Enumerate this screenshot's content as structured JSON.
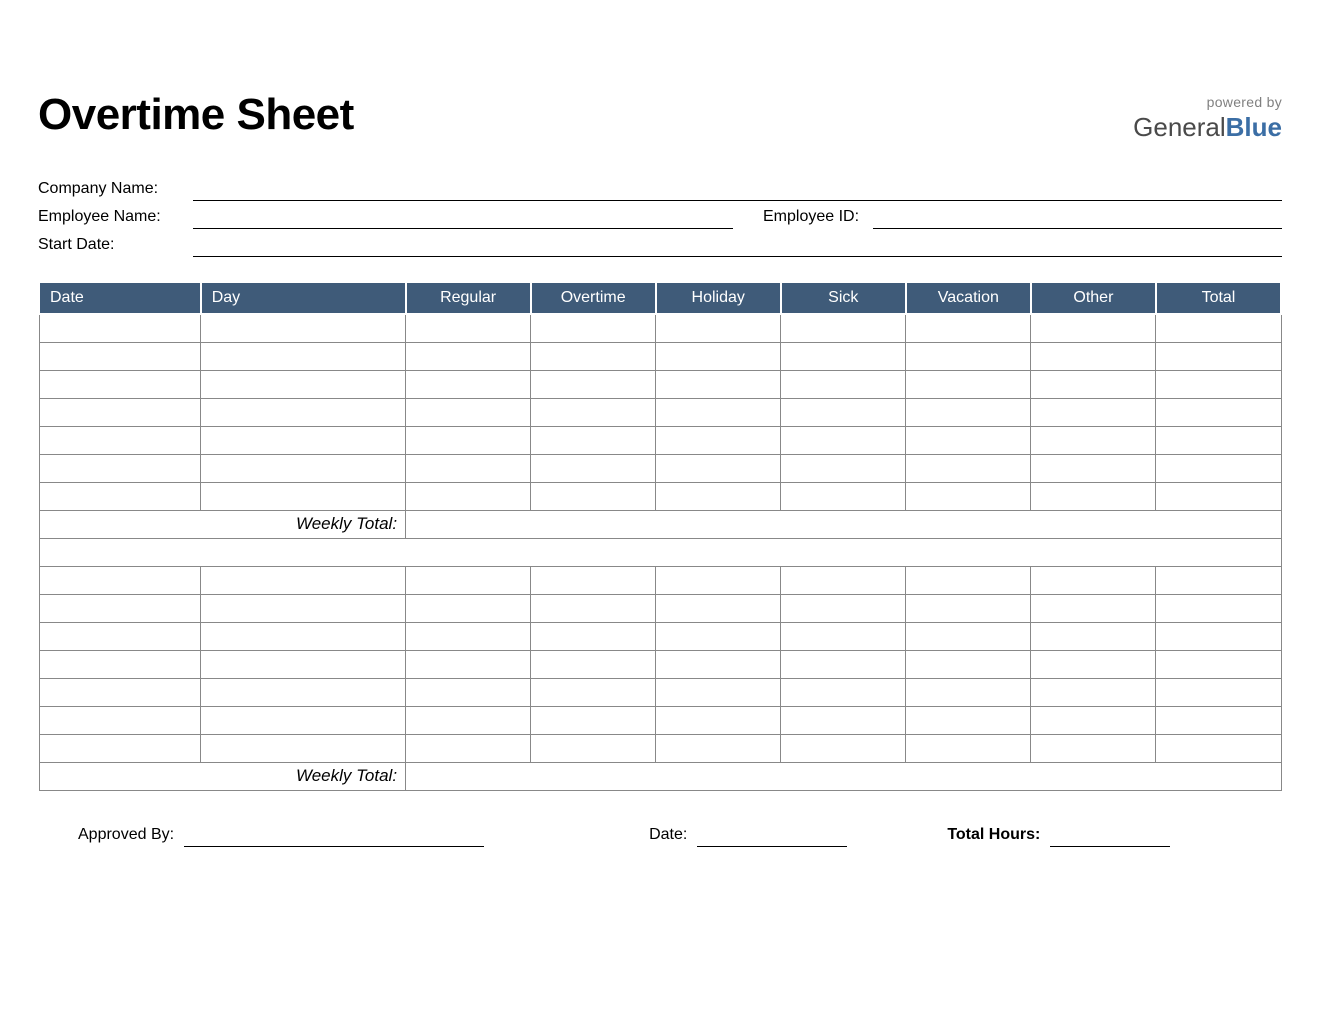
{
  "title": "Overtime Sheet",
  "powered_by": "powered by",
  "logo_general": "General",
  "logo_blue": "Blue",
  "info": {
    "company_name_label": "Company Name:",
    "employee_name_label": "Employee Name:",
    "employee_id_label": "Employee ID:",
    "start_date_label": "Start Date:"
  },
  "table_headers": {
    "date": "Date",
    "day": "Day",
    "regular": "Regular",
    "overtime": "Overtime",
    "holiday": "Holiday",
    "sick": "Sick",
    "vacation": "Vacation",
    "other": "Other",
    "total": "Total"
  },
  "weekly_total_label": "Weekly Total:",
  "footer": {
    "approved_by": "Approved By:",
    "date": "Date:",
    "total_hours": "Total Hours:"
  }
}
